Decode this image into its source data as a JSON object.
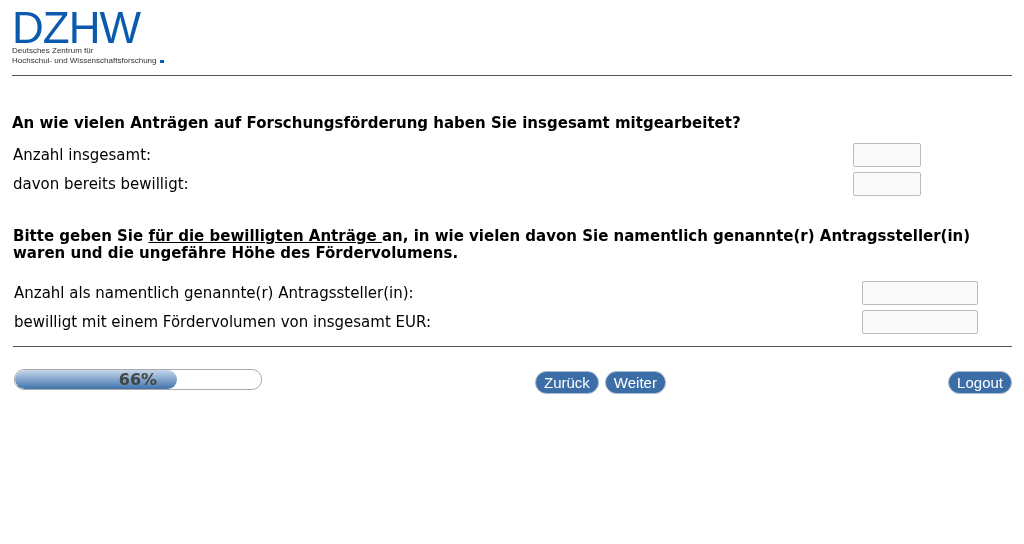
{
  "logo": {
    "wordmark": "DZHW",
    "subtitle": [
      "Deutsches Zentrum für",
      "Hochschul- und Wissenschaftsforschung"
    ]
  },
  "question_1": {
    "title": "An wie vielen Anträgen auf Forschungsförderung haben Sie insgesamt mitgearbeitet?",
    "fields": [
      {
        "label": "Anzahl insgesamt:"
      },
      {
        "label": "davon bereits bewilligt:"
      }
    ]
  },
  "question_2": {
    "title_parts": [
      {
        "text": "Bitte geben Sie ",
        "underline": false
      },
      {
        "text": "für die bewilligten Anträge ",
        "underline": true
      },
      {
        "text": "an, in wie vielen davon Sie namentlich genannte(r) Antragssteller(in) waren und die ungefähre Höhe des Fördervolumens.",
        "underline": false
      }
    ],
    "fields": [
      {
        "label": "Anzahl als namentlich genannte(r) Antragssteller(in):"
      },
      {
        "label": "bewilligt mit einem Fördervolumen von insgesamt EUR:"
      }
    ]
  },
  "progress": {
    "level": 0.66,
    "reading": "66%"
  },
  "buttons": [
    {
      "label": "Zurück"
    },
    {
      "label": "Weiter"
    }
  ],
  "logout": {
    "label": "Logout"
  }
}
